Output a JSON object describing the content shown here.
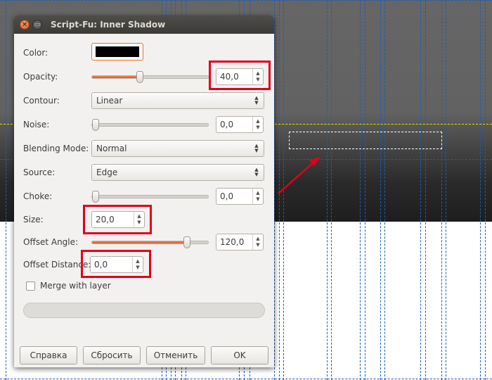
{
  "dialog": {
    "title": "Script-Fu: Inner Shadow",
    "fields": {
      "color_label": "Color:",
      "color_value": "#000000",
      "opacity_label": "Opacity:",
      "opacity_value": "40,0",
      "opacity_level": 0.4,
      "contour_label": "Contour:",
      "contour_value": "Linear",
      "noise_label": "Noise:",
      "noise_value": "0,0",
      "blending_label": "Blending Mode:",
      "blending_value": "Normal",
      "source_label": "Source:",
      "source_value": "Edge",
      "choke_label": "Choke:",
      "choke_value": "0,0",
      "size_label": "Size:",
      "size_value": "20,0",
      "offset_angle_label": "Offset Angle:",
      "offset_angle_value": "120,0",
      "offset_distance_label": "Offset Distance:",
      "offset_distance_value": "0,0",
      "merge_label": "Merge with layer",
      "merge_checked": false
    },
    "buttons": {
      "help": "Справка",
      "reset": "Сбросить",
      "cancel": "Отменить",
      "ok": "OK"
    }
  },
  "colors": {
    "accent": "#e05a2a",
    "highlight": "#e2001a",
    "guide": "#1a5fb4",
    "selection_line": "#e8e000"
  },
  "icons": {
    "close": "close-icon",
    "minimize": "minimize-icon",
    "spin_up": "up-arrow-icon",
    "spin_down": "down-arrow-icon"
  }
}
